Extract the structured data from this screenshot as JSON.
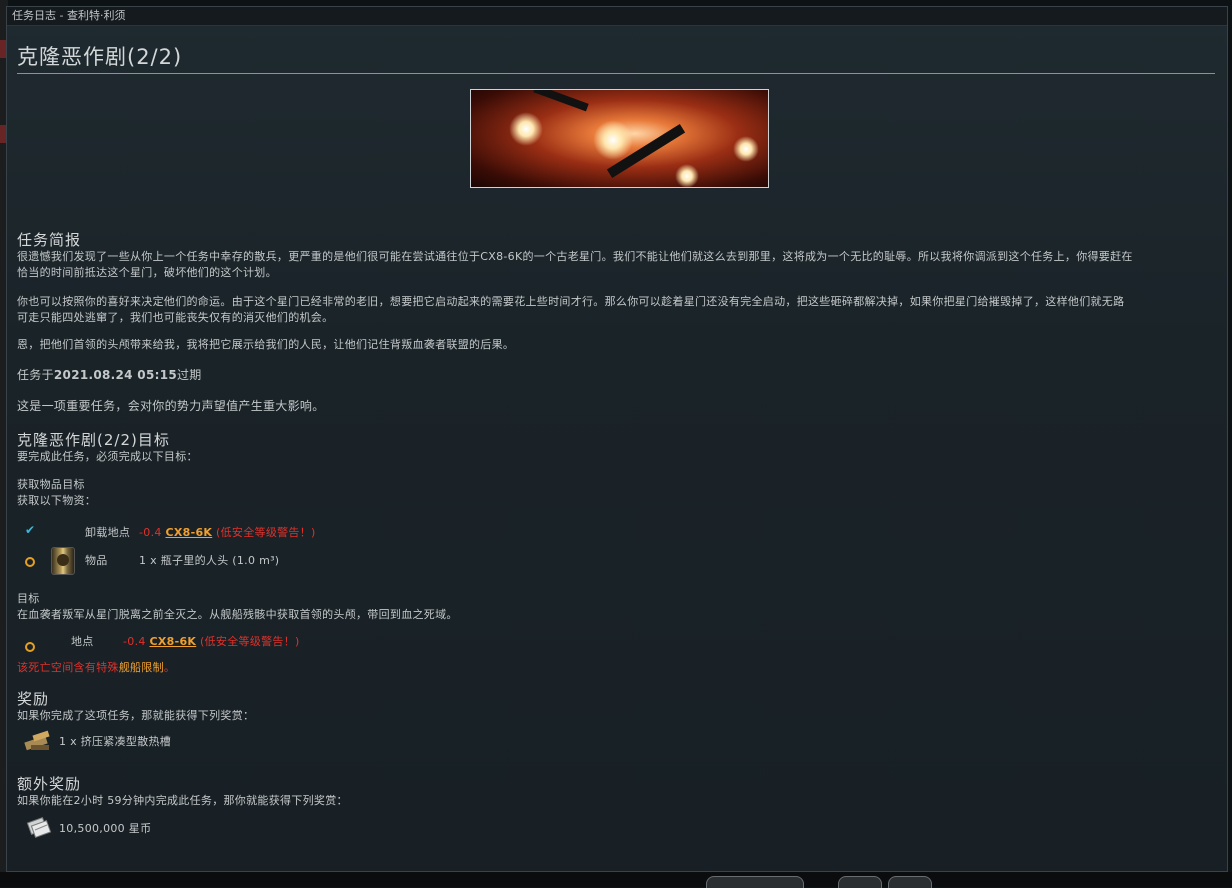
{
  "window": {
    "title": "任务日志 - 查利特·利须"
  },
  "mission": {
    "title": "克隆恶作剧(2/2)",
    "briefing_heading": "任务简报",
    "briefing_p1_line1": "很遗憾我们发现了一些从你上一个任务中幸存的散兵，更严重的是他们很可能在尝试通往位于CX8-6K的一个古老星门。我们不能让他们就这么去到那里，这将成为一个无比的耻辱。所以我将你调派到这个任务上，你得要赶在",
    "briefing_p1_line2": "恰当的时间前抵达这个星门，破坏他们的这个计划。",
    "briefing_p2_line1": "你也可以按照你的喜好来决定他们的命运。由于这个星门已经非常的老旧，想要把它启动起来的需要花上些时间才行。那么你可以趁着星门还没有完全启动，把这些砸碎都解决掉，如果你把星门给摧毁掉了，这样他们就无路",
    "briefing_p2_line2": "可走只能四处逃窜了，我们也可能丧失仅有的消灭他们的机会。",
    "briefing_p3": "恩，把他们首领的头颅带来给我，我将把它展示给我们的人民，让他们记住背叛血袭者联盟的后果。",
    "expiry_prefix": "任务于",
    "expiry_date": "2021.08.24 05:15",
    "expiry_suffix": "过期",
    "importance": "这是一项重要任务，会对你的势力声望值产生重大影响。"
  },
  "objectives": {
    "heading": "克隆恶作剧(2/2)目标",
    "intro": "要完成此任务，必须完成以下目标：",
    "fetch_heading": "获取物品目标",
    "fetch_intro": "获取以下物资：",
    "dropoff_label": "卸载地点",
    "dropoff_security": "-0.4",
    "dropoff_system": "CX8-6K",
    "dropoff_warning": "(低安全等级警告！)",
    "item_label": "物品",
    "item_value": "1 x 瓶子里的人头 (1.0 m³)",
    "goal_heading": "目标",
    "goal_text": "在血袭者叛军从星门脱离之前全灭之。从舰船残骸中获取首领的头颅，带回到血之死域。",
    "location_label": "地点",
    "location_security": "-0.4",
    "location_system": "CX8-6K",
    "location_warning": "(低安全等级警告！)",
    "restriction_prefix": "该死亡空间含有特殊",
    "restriction_highlight": "舰船限制",
    "restriction_suffix": "。"
  },
  "rewards": {
    "heading": "奖励",
    "intro": "如果你完成了这项任务，那就能获得下列奖赏：",
    "item": "1 x 挤压紧凑型散热槽"
  },
  "bonus": {
    "heading": "额外奖励",
    "intro": "如果你能在2小时 59分钟内完成此任务，那你就能获得下列奖赏：",
    "item": "10,500,000 星币"
  },
  "icons": {
    "check": "checkmark-icon",
    "pending": "ring-icon",
    "item": "cargo-container-icon",
    "reward": "heat-sink-icon",
    "isk": "isk-icon"
  },
  "colors": {
    "security_negative": "#e0312b",
    "system_link": "#f0a030",
    "check": "#3fb8d8",
    "pending_ring": "#e6a020"
  }
}
